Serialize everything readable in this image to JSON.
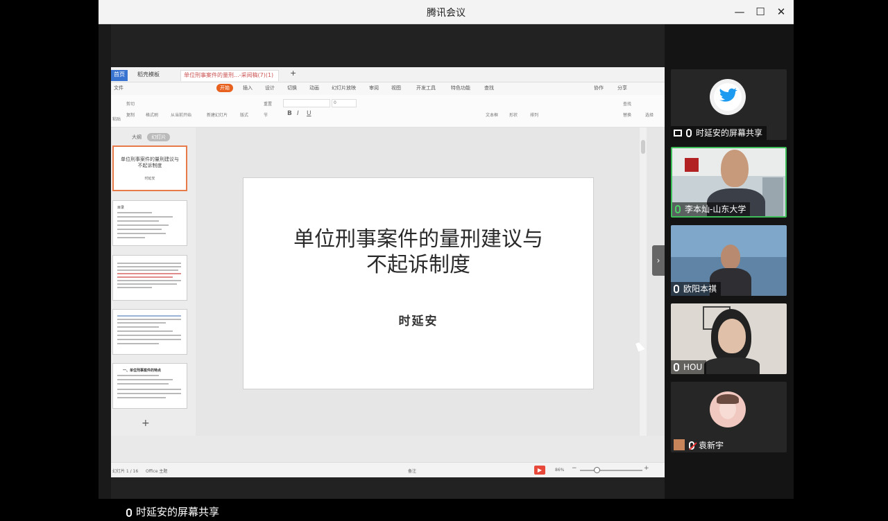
{
  "window": {
    "title": "腾讯会议",
    "minimize": "—",
    "maximize": "☐",
    "close": "✕"
  },
  "wps": {
    "tabs": [
      {
        "label": "首页"
      },
      {
        "label": "稻壳模板"
      },
      {
        "label": "单位刑事案件的量刑...-采阅稿(7)(1)"
      }
    ],
    "new_tab": "+",
    "menu": [
      "文件",
      "开始",
      "插入",
      "设计",
      "切换",
      "动画",
      "幻灯片放映",
      "审阅",
      "视图",
      "开发工具",
      "特色功能",
      "查找"
    ],
    "menu_right": [
      "协作",
      "分享"
    ],
    "ribbon": {
      "groups": [
        "粘贴",
        "剪切",
        "复制",
        "格式刷",
        "从当前开始",
        "新建幻灯片",
        "版式",
        "重置",
        "节",
        "文本框",
        "形状",
        "排列",
        "查找",
        "替换",
        "选择"
      ],
      "font_size": "0"
    },
    "view_tabs": [
      "大纲",
      "幻灯片"
    ],
    "thumbnails": {
      "first": {
        "title": "单位刑事案件的量刑建议与不起诉制度",
        "author": "时延安"
      },
      "second_heading": "目录",
      "fifth_heading": "一、单位刑事案件的特点"
    },
    "slide": {
      "title_line1": "单位刑事案件的量刑建议与",
      "title_line2": "不起诉制度",
      "author": "时延安"
    },
    "status": {
      "page": "幻灯片 1 / 16",
      "theme": "Office 主题",
      "notes": "备注",
      "zoom": "86%"
    }
  },
  "share_label": "时延安的屏幕共享",
  "participants": [
    {
      "name": "时延安的屏幕共享",
      "avatar": "twitter-bird",
      "speaking": false,
      "muted": false
    },
    {
      "name": "李本灿-山东大学",
      "speaking": true,
      "muted": false
    },
    {
      "name": "欧阳本祺",
      "speaking": false,
      "muted": false
    },
    {
      "name": "HOU",
      "speaking": false,
      "muted": false
    },
    {
      "name": "袁新宇",
      "speaking": false,
      "muted": true
    }
  ],
  "colors": {
    "accent": "#e8601e",
    "speaking": "#3fbf5a",
    "twitter": "#1d9bf0"
  }
}
